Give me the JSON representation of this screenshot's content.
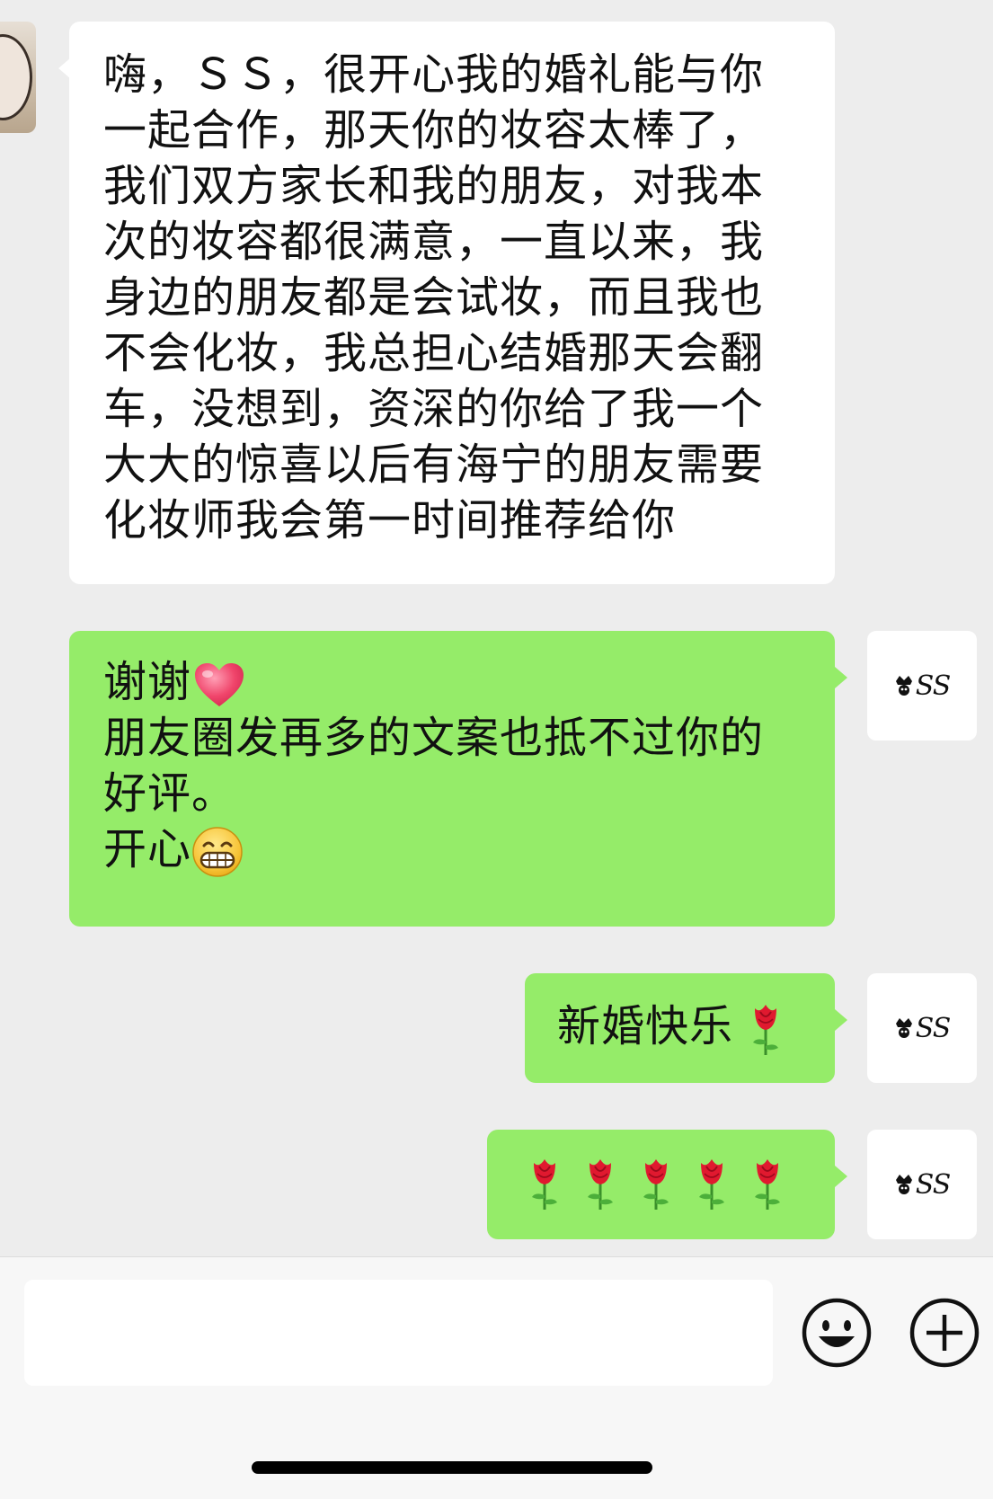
{
  "chat": {
    "messages": [
      {
        "sender": "other",
        "text": "嗨，ＳＳ，很开心我的婚礼能与你\n一起合作，那天你的妆容太棒了，\n我们双方家长和我的朋友，对我本\n次的妆容都很满意，一直以来，我\n身边的朋友都是会试妆，而且我也\n不会化妆，我总担心结婚那天会翻\n车，没想到，资深的你给了我一个\n大大的惊喜以后有海宁的朋友需要\n化妆师我会第一时间推荐给你"
      },
      {
        "sender": "me",
        "line1": "谢谢",
        "line2": "朋友圈发再多的文案也抵不过你的\n好评。",
        "line3": "开心",
        "emojis": [
          "heart-emoji",
          "grin-emoji"
        ]
      },
      {
        "sender": "me",
        "text": "新婚快乐",
        "emojis": [
          "rose-emoji"
        ]
      },
      {
        "sender": "me",
        "text": "",
        "emojis": [
          "rose-emoji",
          "rose-emoji",
          "rose-emoji",
          "rose-emoji",
          "rose-emoji"
        ]
      }
    ]
  },
  "avatar": {
    "my_logo_text": "SS"
  },
  "input": {
    "value": "",
    "placeholder": ""
  },
  "icons": {
    "emoji_button": "smiley-icon",
    "plus_button": "plus-circle-icon"
  },
  "colors": {
    "background": "#ededed",
    "incoming_bubble": "#ffffff",
    "outgoing_bubble": "#95ec69"
  }
}
